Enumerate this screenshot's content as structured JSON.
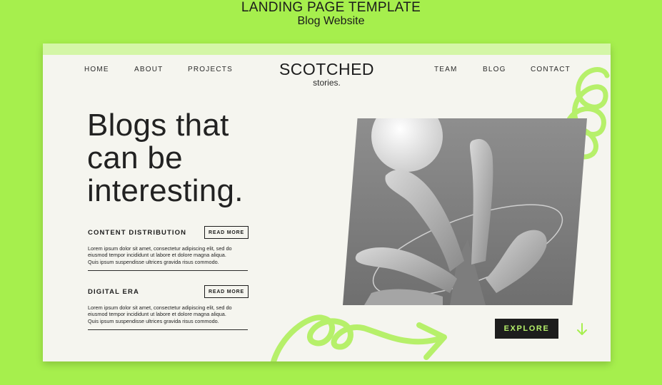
{
  "showcase": {
    "title": "LANDING PAGE TEMPLATE",
    "subtitle": "Blog Website"
  },
  "nav": {
    "left": [
      "HOME",
      "ABOUT",
      "PROJECTS"
    ],
    "right": [
      "TEAM",
      "BLOG",
      "CONTACT"
    ]
  },
  "brand": {
    "name": "SCOTCHED",
    "tagline": "stories."
  },
  "hero": {
    "title_lines": [
      "Blogs that",
      "can be",
      "interesting."
    ]
  },
  "sections": [
    {
      "heading": "CONTENT DISTRIBUTION",
      "button": "READ MORE",
      "lines": [
        "Lorem ipsum dolor sit amet, consectetur adipiscing elit, sed do",
        "eiusmod tempor incididunt ut labore et dolore magna aliqua.",
        "Quis ipsum suspendisse ultrices gravida risus commodo."
      ]
    },
    {
      "heading": "DIGITAL ERA",
      "button": "READ MORE",
      "lines": [
        "Lorem ipsum dolor sit amet, consectetur adipiscing elit, sed do",
        "eiusmod tempor incididunt ut labore et dolore magna aliqua.",
        "Quis ipsum suspendisse ultrices gravida risus commodo."
      ]
    }
  ],
  "cta": {
    "explore_label": "EXPLORE"
  },
  "icons": {
    "down_arrow": "down-arrow-icon"
  },
  "colors": {
    "background": "#a6ef4d",
    "page": "#f5f5ef",
    "accent": "#b6f06a",
    "dark": "#1d1d1d"
  }
}
